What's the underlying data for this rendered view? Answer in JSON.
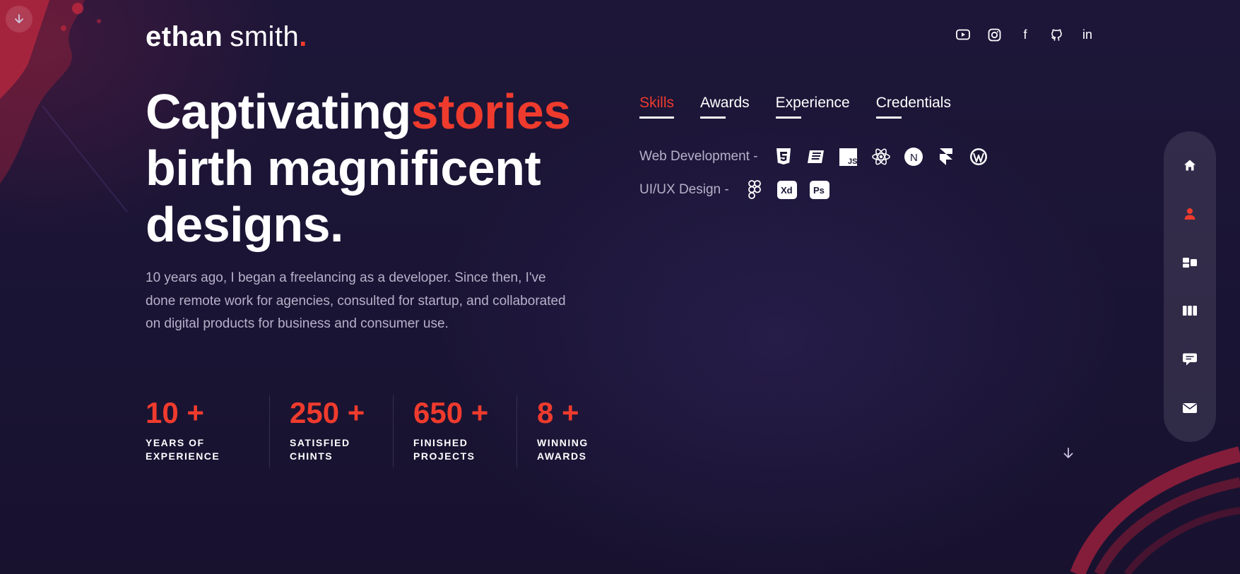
{
  "header": {
    "logo_first": "ethan",
    "logo_last": "smith",
    "logo_dot": ".",
    "socials": [
      {
        "icon": "youtube-icon"
      },
      {
        "icon": "instagram-icon"
      },
      {
        "icon": "facebook-icon",
        "glyph": "f"
      },
      {
        "icon": "github-icon"
      },
      {
        "icon": "linkedin-icon",
        "glyph": "in"
      }
    ]
  },
  "hero": {
    "headline_white_1": "Captivating",
    "headline_red": "stories",
    "headline_line_2": "birth magnificent",
    "headline_line_3": "designs.",
    "intro": "10 years ago, I began a freelancing as a developer. Since then, I've done remote work for agencies, consulted for startup, and collaborated on digital products for business and consumer use."
  },
  "stats": [
    {
      "number": "10 +",
      "label_1": "YEARS OF",
      "label_2": "EXPERIENCE"
    },
    {
      "number": "250 +",
      "label_1": "SATISFIED",
      "label_2": "CHINTS"
    },
    {
      "number": "650 +",
      "label_1": "FINISHED",
      "label_2": "PROJECTS"
    },
    {
      "number": "8 +",
      "label_1": "WINNING",
      "label_2": "AWARDS"
    }
  ],
  "tabs": [
    {
      "label": "Skills",
      "active": true
    },
    {
      "label": "Awards",
      "active": false
    },
    {
      "label": "Experience",
      "active": false
    },
    {
      "label": "Credentials",
      "active": false
    }
  ],
  "skills": [
    {
      "label": "Web Development  -",
      "icons": [
        "html5-icon",
        "css3-icon",
        "javascript-icon",
        "react-icon",
        "nextjs-icon",
        "framer-icon",
        "wordpress-icon"
      ]
    },
    {
      "label": "UI/UX Design  -",
      "icons": [
        "figma-icon",
        "adobe-xd-icon",
        "photoshop-icon"
      ]
    }
  ],
  "icon_text": {
    "js": "JS",
    "next": "N",
    "xd": "Xd",
    "ps": "Ps"
  },
  "sidenav": [
    "home-icon",
    "user-icon",
    "portfolio-icon",
    "services-icon",
    "testimonials-icon",
    "contact-icon"
  ],
  "colors": {
    "accent": "#ef3b2d",
    "background": "#1b1535",
    "muted_text": "#b7b1c9",
    "active_nav": "#ef3b2d"
  }
}
